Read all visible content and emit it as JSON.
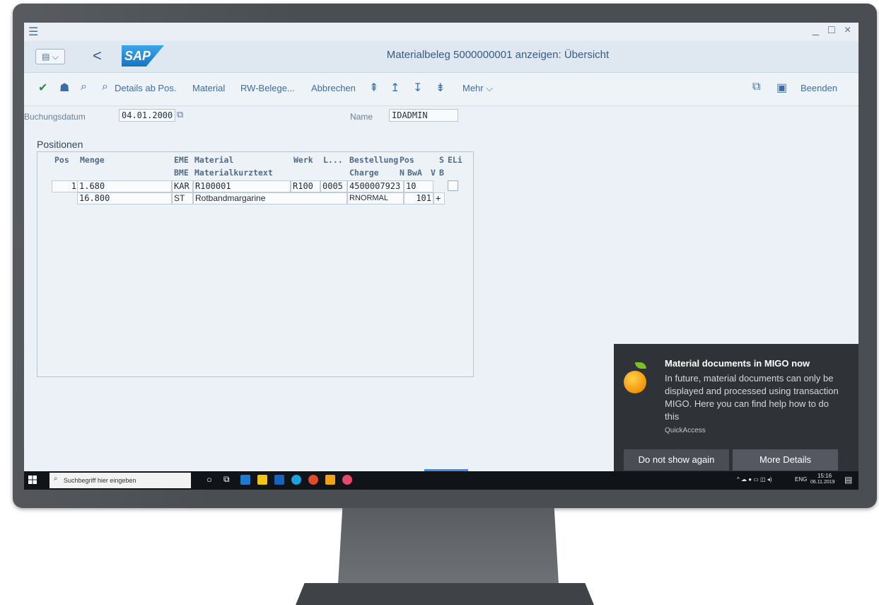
{
  "window": {
    "title": "Materialbeleg 5000000001 anzeigen: Übersicht",
    "menu_icon": "hamburger-icon",
    "controls": [
      "_",
      "□",
      "×"
    ]
  },
  "shell": {
    "menu_button_label": "▤ ⌵",
    "back_label": "<",
    "logo": "SAP"
  },
  "toolbar": {
    "details": "Details ab Pos.",
    "material": "Material",
    "rw_belege": "RW-Belege...",
    "abbrechen": "Abbrechen",
    "mehr": "Mehr",
    "beenden": "Beenden"
  },
  "header": {
    "buchungsdatum_label": "Buchungsdatum",
    "buchungsdatum_value": "04.01.2000",
    "name_label": "Name",
    "name_value": "IDADMIN"
  },
  "positionen": {
    "title": "Positionen",
    "headers_row1": {
      "pos": "Pos",
      "menge": "Menge",
      "eme": "EME",
      "material": "Material",
      "werk": "Werk",
      "l": "L...",
      "bestellung": "Bestellung",
      "pos2": "Pos",
      "s": "S",
      "el": "ELi"
    },
    "headers_row2": {
      "bme": "BME",
      "kurztext": "Materialkurztext",
      "charge": "Charge",
      "n": "N",
      "bwa": "BwA",
      "v": "V",
      "b": "B"
    },
    "rows": [
      {
        "pos": "1",
        "menge": "1.680",
        "eme": "KAR",
        "material": "R100001",
        "werk": "R100",
        "l": "0005",
        "bestellung": "4500007923",
        "bestpos": "10"
      },
      {
        "menge2": "16.800",
        "bme": "ST",
        "kurztext": "Rotbandmargarine",
        "charge": "RNORMAL",
        "bwa": "101",
        "plus": "+"
      }
    ]
  },
  "notification": {
    "title": "Material documents in MIGO now",
    "body": "In future, material documents can only be displayed and processed using transaction MIGO. Here you can find help how to do this",
    "source": "QuickAccess",
    "btn_dismiss": "Do not show again",
    "btn_details": "More Details"
  },
  "taskbar": {
    "search_placeholder": "Suchbegriff hier eingeben",
    "lang": "ENG",
    "time": "15:16",
    "date": "06.11.2019"
  },
  "colors": {
    "sap_blue": "#1c72c3",
    "screen_bg": "#ebf1f6",
    "toast_bg": "#2f3237"
  }
}
